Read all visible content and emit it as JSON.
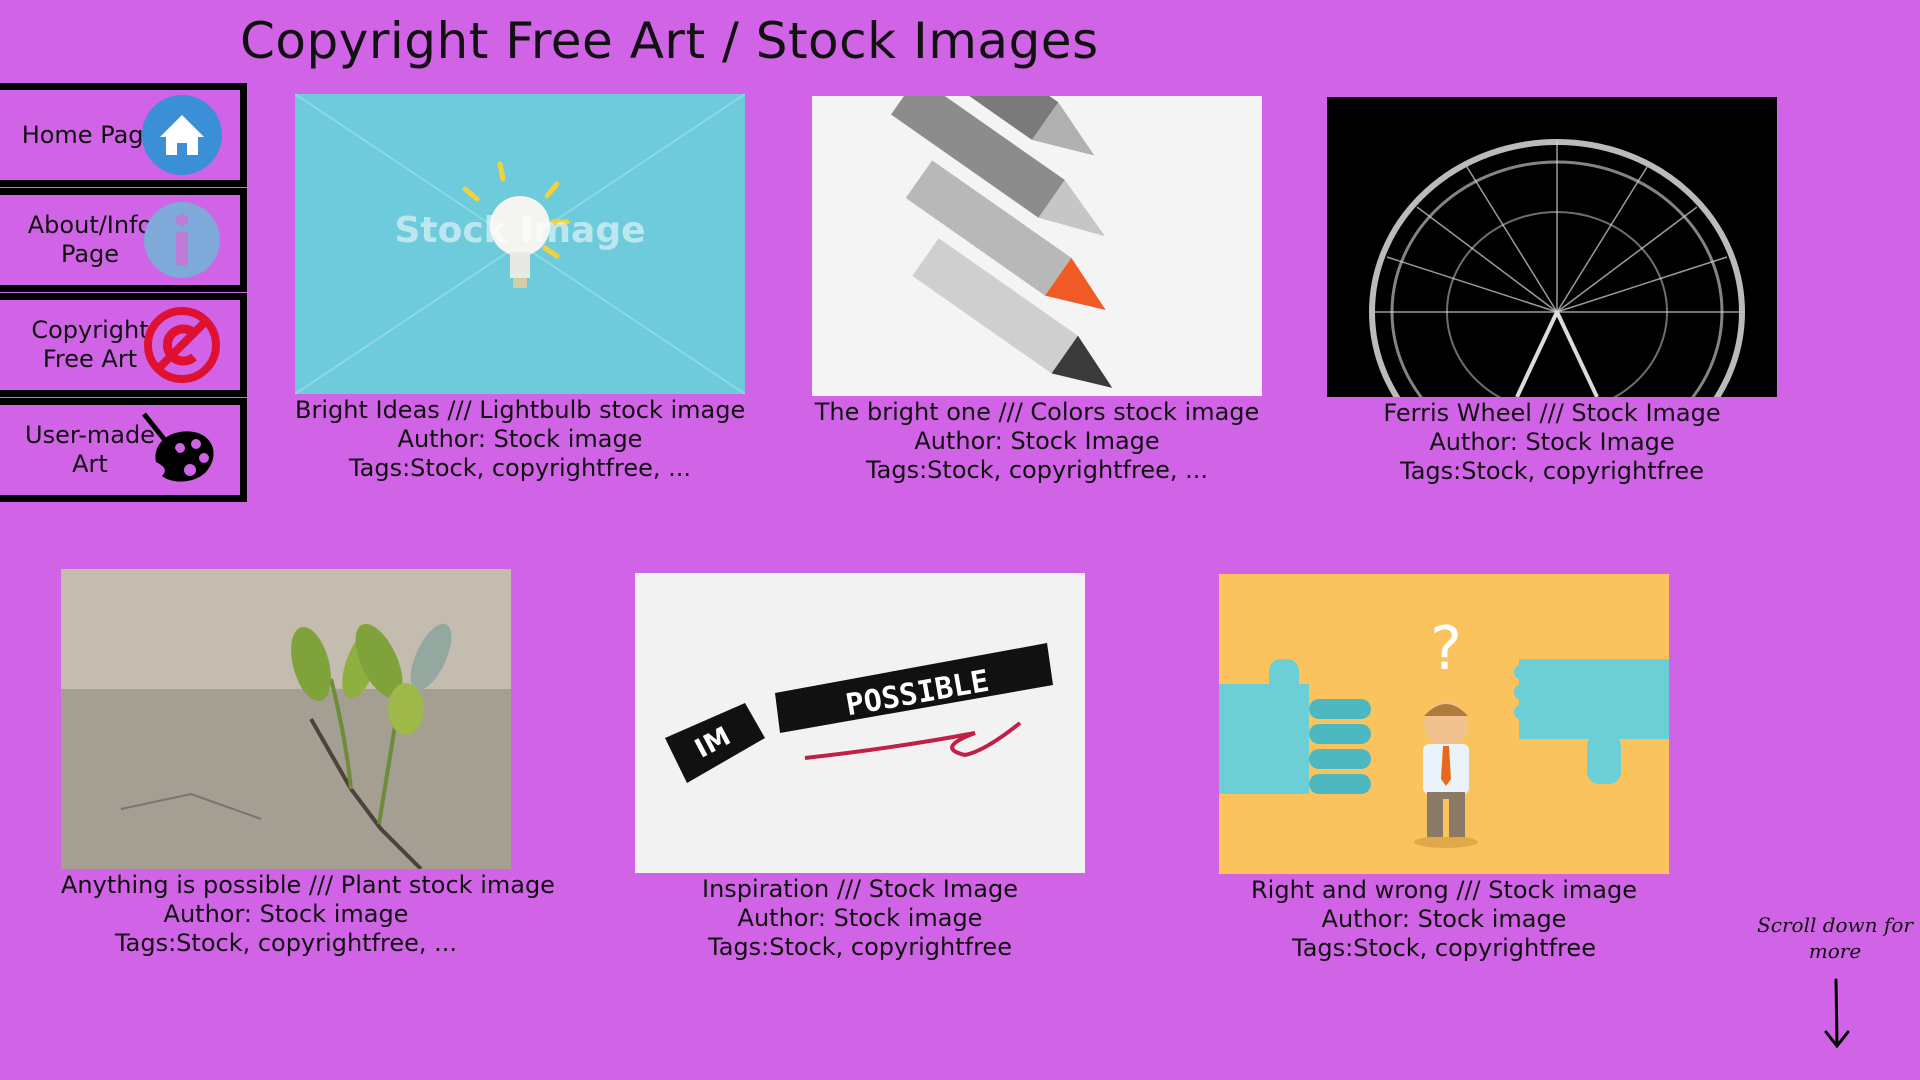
{
  "page": {
    "title": "Copyright Free Art / Stock Images"
  },
  "sidebar": {
    "items": [
      {
        "label": "Home Page",
        "icon": "home-icon"
      },
      {
        "label": "About/Info Page",
        "icon": "info-icon"
      },
      {
        "label": "Copyright Free Art",
        "icon": "copyright-free-icon"
      },
      {
        "label": "User-made Art",
        "icon": "palette-icon"
      }
    ]
  },
  "gallery": {
    "items": [
      {
        "title": "Bright Ideas /// Lightbulb stock image",
        "author": "Author: Stock image",
        "tags": "Tags:Stock, copyrightfree, ...",
        "watermark": "Stock Image"
      },
      {
        "title": "The bright one /// Colors stock image",
        "author": "Author: Stock Image",
        "tags": "Tags:Stock, copyrightfree, ..."
      },
      {
        "title": "Ferris Wheel /// Stock Image",
        "author": "Author: Stock Image",
        "tags": "Tags:Stock, copyrightfree"
      },
      {
        "title": "Anything is possible /// Plant stock image",
        "author": "Author: Stock image",
        "tags": "Tags:Stock, copyrightfree, ..."
      },
      {
        "title": "Inspiration /// Stock Image",
        "author": "Author: Stock image",
        "tags": "Tags:Stock, copyrightfree",
        "image_text": "POSSIBLE"
      },
      {
        "title": "Right and wrong /// Stock image",
        "author": "Author: Stock image",
        "tags": "Tags:Stock, copyrightfree",
        "image_text": "?"
      }
    ]
  },
  "scroll_hint": {
    "text": "Scroll down for more"
  },
  "colors": {
    "background": "#d163e6",
    "border": "#000000",
    "home_icon": "#3a8fd6",
    "info_icon": "#7fa9d8",
    "copyright_icon": "#e01030"
  }
}
